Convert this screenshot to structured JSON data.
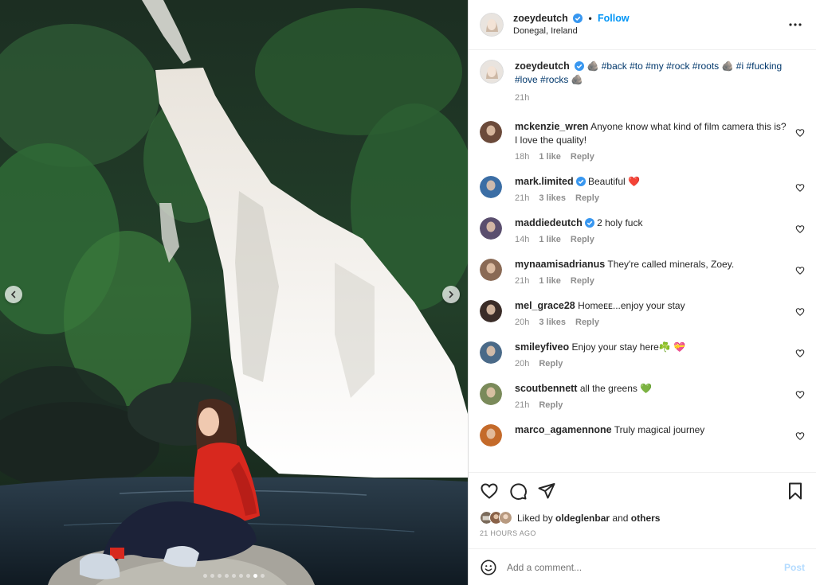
{
  "post": {
    "author": "zoeydeutch",
    "follow_label": "Follow",
    "location": "Donegal, Ireland"
  },
  "caption": {
    "author": "zoeydeutch",
    "emoji": "🪨",
    "tags_line_1": "#back #to #my #rock #roots",
    "tags_line_2": "#i #fucking",
    "tags_line_3": "#love #rocks",
    "time": "21h"
  },
  "comments": [
    {
      "user": "mckenzie_wren",
      "verified": false,
      "text": "Anyone know what kind of film camera this is? I love the quality!",
      "time": "18h",
      "likes": "1 like",
      "reply": "Reply",
      "avatar_color": "#6b4a3a"
    },
    {
      "user": "mark.limited",
      "verified": true,
      "text": "Beautiful ❤️",
      "time": "21h",
      "likes": "3 likes",
      "reply": "Reply",
      "avatar_color": "#3b6ea5"
    },
    {
      "user": "maddiedeutch",
      "verified": true,
      "text": "2 holy fuck",
      "time": "14h",
      "likes": "1 like",
      "reply": "Reply",
      "avatar_color": "#5a4e6e"
    },
    {
      "user": "mynaamisadrianus",
      "verified": false,
      "text": "They're called minerals, Zoey.",
      "time": "21h",
      "likes": "1 like",
      "reply": "Reply",
      "avatar_color": "#8a6a55"
    },
    {
      "user": "mel_grace28",
      "verified": false,
      "text": "Homeᴇᴇ...enjoy your stay",
      "time": "20h",
      "likes": "3 likes",
      "reply": "Reply",
      "avatar_color": "#3a2c28"
    },
    {
      "user": "smileyfiveo",
      "verified": false,
      "text": "Enjoy your stay here☘️ 💝",
      "time": "20h",
      "likes": "",
      "reply": "Reply",
      "avatar_color": "#4a6a88"
    },
    {
      "user": "scoutbennett",
      "verified": false,
      "text": "all the greens 💚",
      "time": "21h",
      "likes": "",
      "reply": "Reply",
      "avatar_color": "#7a8a5a"
    },
    {
      "user": "marco_agamennone",
      "verified": false,
      "text": "Truly magical journey",
      "time": "",
      "likes": "",
      "reply": "",
      "avatar_color": "#c46a2a"
    }
  ],
  "likes_summary": {
    "prefix": "Liked by",
    "user": "oldeglenbar",
    "joiner": "and",
    "others": "others"
  },
  "timestamp": "21 HOURS AGO",
  "add_comment": {
    "placeholder": "Add a comment...",
    "post_label": "Post"
  },
  "carousel": {
    "count": 9,
    "active_index": 7
  },
  "colors": {
    "link_blue": "#0095f6",
    "tag_blue": "#00376b",
    "verified_blue": "#3897f0",
    "muted": "#8e8e8e"
  },
  "icons": [
    "heart-icon",
    "comment-icon",
    "share-icon",
    "save-icon",
    "more-icon",
    "emoji-icon",
    "chevron-left-icon",
    "chevron-right-icon",
    "verified-icon"
  ]
}
